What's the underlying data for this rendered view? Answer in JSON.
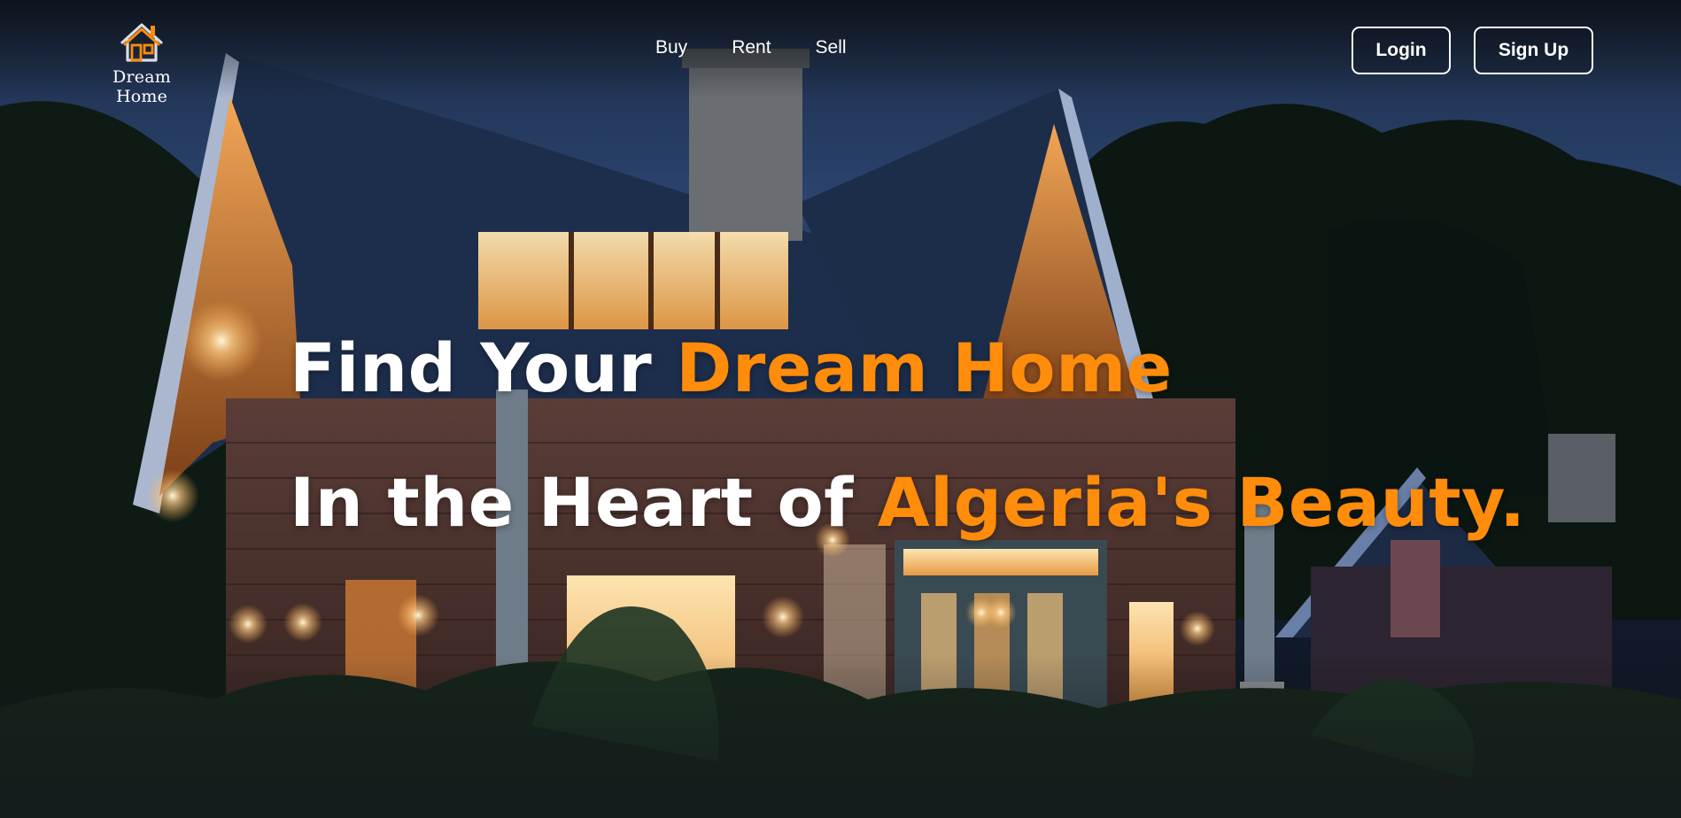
{
  "app": {
    "brand": "Dream Home",
    "logo_icon": "house-icon",
    "colors": {
      "accent": "#ff8c0a",
      "text": "#ffffff",
      "night_sky": "#223555"
    }
  },
  "nav": {
    "items": [
      {
        "label": "Buy"
      },
      {
        "label": "Rent"
      },
      {
        "label": "Sell"
      }
    ]
  },
  "auth": {
    "login_label": "Login",
    "signup_label": "Sign Up"
  },
  "hero": {
    "line1_prefix": "Find Your ",
    "line1_accent": "Dream Home",
    "line2_prefix": "In the Heart of ",
    "line2_accent": "Algeria's Beauty."
  }
}
